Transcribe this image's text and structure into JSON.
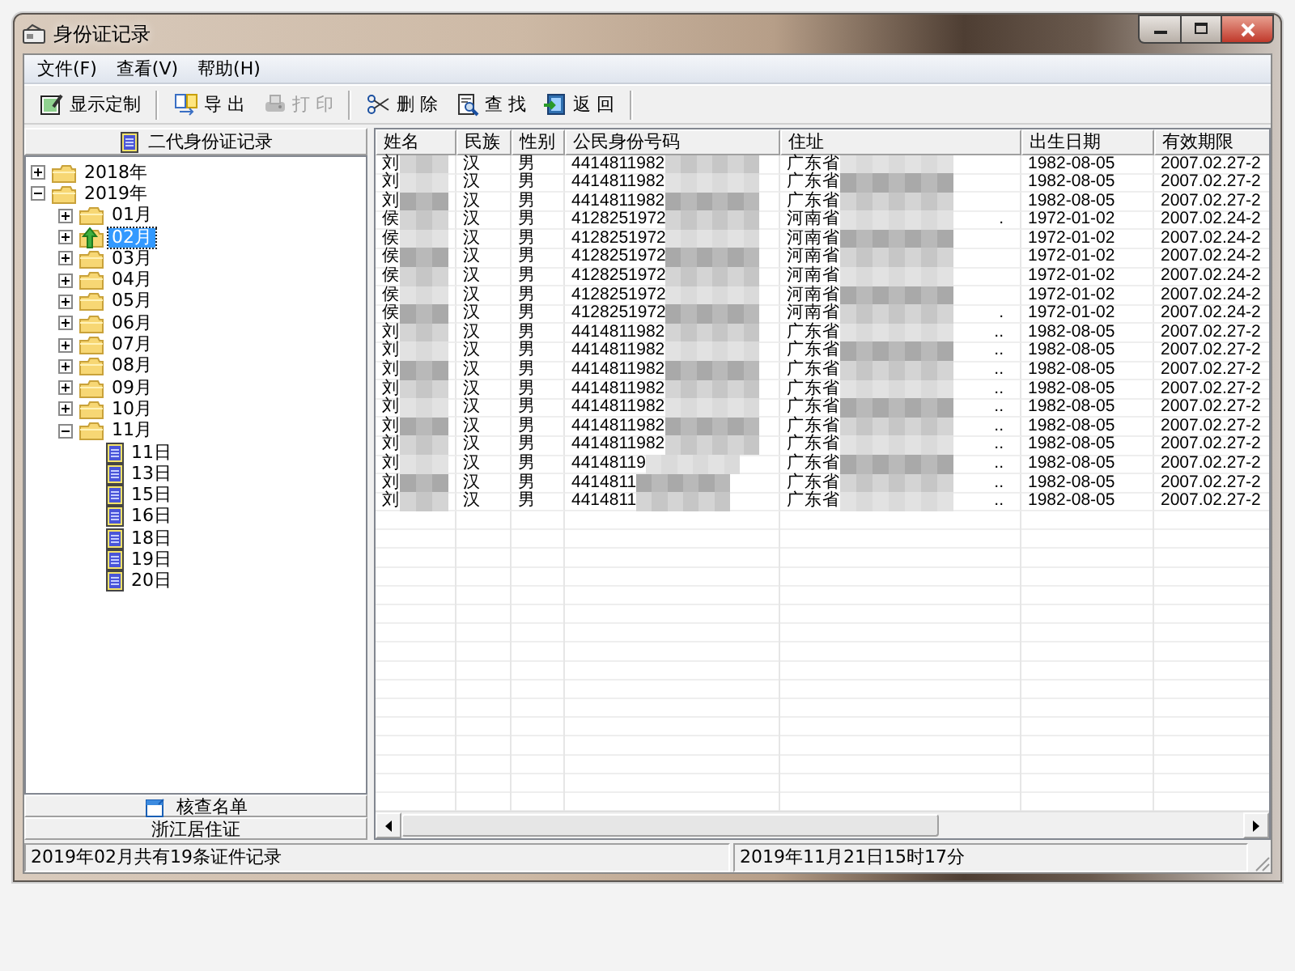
{
  "window": {
    "title": "身份证记录"
  },
  "menu": [
    "文件(F)",
    "查看(V)",
    "帮助(H)"
  ],
  "toolbar": [
    {
      "items": [
        {
          "label": "显示定制",
          "disabled": false
        }
      ]
    },
    {
      "items": [
        {
          "label": "导 出",
          "disabled": false
        },
        {
          "label": "打 印",
          "disabled": true
        }
      ]
    },
    {
      "items": [
        {
          "label": "删 除",
          "disabled": false
        },
        {
          "label": "查 找",
          "disabled": false
        },
        {
          "label": "返 回",
          "disabled": false
        }
      ]
    }
  ],
  "sidebar": {
    "title": "二代身份证记录",
    "tree": [
      {
        "label": "2018年",
        "kind": "folder",
        "expanded": false,
        "selected": false
      },
      {
        "label": "2019年",
        "kind": "folder",
        "expanded": true,
        "selected": false,
        "children": [
          {
            "label": "01月",
            "kind": "folder",
            "expanded": false,
            "selected": false
          },
          {
            "label": "02月",
            "kind": "folder",
            "expanded": false,
            "selected": true
          },
          {
            "label": "03月",
            "kind": "folder",
            "expanded": false,
            "selected": false
          },
          {
            "label": "04月",
            "kind": "folder",
            "expanded": false,
            "selected": false
          },
          {
            "label": "05月",
            "kind": "folder",
            "expanded": false,
            "selected": false
          },
          {
            "label": "06月",
            "kind": "folder",
            "expanded": false,
            "selected": false
          },
          {
            "label": "07月",
            "kind": "folder",
            "expanded": false,
            "selected": false
          },
          {
            "label": "08月",
            "kind": "folder",
            "expanded": false,
            "selected": false
          },
          {
            "label": "09月",
            "kind": "folder",
            "expanded": false,
            "selected": false
          },
          {
            "label": "10月",
            "kind": "folder",
            "expanded": false,
            "selected": false
          },
          {
            "label": "11月",
            "kind": "folder",
            "expanded": true,
            "selected": false,
            "children": [
              {
                "label": "11日",
                "kind": "day",
                "selected": false
              },
              {
                "label": "13日",
                "kind": "day",
                "selected": false
              },
              {
                "label": "15日",
                "kind": "day",
                "selected": false
              },
              {
                "label": "16日",
                "kind": "day",
                "selected": false
              },
              {
                "label": "18日",
                "kind": "day",
                "selected": false
              },
              {
                "label": "19日",
                "kind": "day",
                "selected": false
              },
              {
                "label": "20日",
                "kind": "day",
                "selected": false
              }
            ]
          }
        ]
      }
    ],
    "bottom_buttons": [
      "核查名单",
      "浙江居住证"
    ]
  },
  "table": {
    "columns": [
      "姓名",
      "民族",
      "性别",
      "公民身份号码",
      "住址",
      "出生日期",
      "有效期限"
    ],
    "rows": [
      {
        "name": "刘",
        "ethnicity": "汉",
        "sex": "男",
        "id_number": "4414811982",
        "address": "广东省",
        "birth_date": "1982-08-05",
        "valid_period": "2007.02.27-2"
      },
      {
        "name": "刘",
        "ethnicity": "汉",
        "sex": "男",
        "id_number": "4414811982",
        "address": "广东省",
        "birth_date": "1982-08-05",
        "valid_period": "2007.02.27-2"
      },
      {
        "name": "刘",
        "ethnicity": "汉",
        "sex": "男",
        "id_number": "4414811982",
        "address": "广东省",
        "birth_date": "1982-08-05",
        "valid_period": "2007.02.27-2"
      },
      {
        "name": "侯",
        "ethnicity": "汉",
        "sex": "男",
        "id_number": "4128251972",
        "address": "河南省",
        "address_end": ".",
        "birth_date": "1972-01-02",
        "valid_period": "2007.02.24-2"
      },
      {
        "name": "侯",
        "ethnicity": "汉",
        "sex": "男",
        "id_number": "4128251972",
        "address": "河南省",
        "birth_date": "1972-01-02",
        "valid_period": "2007.02.24-2"
      },
      {
        "name": "侯",
        "ethnicity": "汉",
        "sex": "男",
        "id_number": "4128251972",
        "address": "河南省",
        "birth_date": "1972-01-02",
        "valid_period": "2007.02.24-2"
      },
      {
        "name": "侯",
        "ethnicity": "汉",
        "sex": "男",
        "id_number": "4128251972",
        "address": "河南省",
        "birth_date": "1972-01-02",
        "valid_period": "2007.02.24-2"
      },
      {
        "name": "侯",
        "ethnicity": "汉",
        "sex": "男",
        "id_number": "4128251972",
        "address": "河南省",
        "birth_date": "1972-01-02",
        "valid_period": "2007.02.24-2"
      },
      {
        "name": "侯",
        "ethnicity": "汉",
        "sex": "男",
        "id_number": "4128251972",
        "address": "河南省",
        "address_end": ".",
        "birth_date": "1972-01-02",
        "valid_period": "2007.02.24-2"
      },
      {
        "name": "刘",
        "ethnicity": "汉",
        "sex": "男",
        "id_number": "4414811982",
        "address": "广东省",
        "address_end": "..",
        "birth_date": "1982-08-05",
        "valid_period": "2007.02.27-2"
      },
      {
        "name": "刘",
        "ethnicity": "汉",
        "sex": "男",
        "id_number": "4414811982",
        "address": "广东省",
        "address_end": "..",
        "birth_date": "1982-08-05",
        "valid_period": "2007.02.27-2"
      },
      {
        "name": "刘",
        "ethnicity": "汉",
        "sex": "男",
        "id_number": "4414811982",
        "address": "广东省",
        "address_end": "..",
        "birth_date": "1982-08-05",
        "valid_period": "2007.02.27-2"
      },
      {
        "name": "刘",
        "ethnicity": "汉",
        "sex": "男",
        "id_number": "4414811982",
        "address": "广东省",
        "address_end": "..",
        "birth_date": "1982-08-05",
        "valid_period": "2007.02.27-2"
      },
      {
        "name": "刘",
        "ethnicity": "汉",
        "sex": "男",
        "id_number": "4414811982",
        "address": "广东省",
        "address_end": "..",
        "birth_date": "1982-08-05",
        "valid_period": "2007.02.27-2"
      },
      {
        "name": "刘",
        "ethnicity": "汉",
        "sex": "男",
        "id_number": "4414811982",
        "address": "广东省",
        "address_end": "..",
        "birth_date": "1982-08-05",
        "valid_period": "2007.02.27-2"
      },
      {
        "name": "刘",
        "ethnicity": "汉",
        "sex": "男",
        "id_number": "4414811982",
        "address": "广东省",
        "address_end": "..",
        "birth_date": "1982-08-05",
        "valid_period": "2007.02.27-2"
      },
      {
        "name": "刘",
        "ethnicity": "汉",
        "sex": "男",
        "id_number": "44148119",
        "address": "广东省",
        "address_end": "..",
        "birth_date": "1982-08-05",
        "valid_period": "2007.02.27-2"
      },
      {
        "name": "刘",
        "ethnicity": "汉",
        "sex": "男",
        "id_number": "4414811",
        "address": "广东省",
        "address_end": "..",
        "birth_date": "1982-08-05",
        "valid_period": "2007.02.27-2"
      },
      {
        "name": "刘",
        "ethnicity": "汉",
        "sex": "男",
        "id_number": "4414811",
        "address": "广东省",
        "address_end": "..",
        "birth_date": "1982-08-05",
        "valid_period": "2007.02.27-2"
      }
    ]
  },
  "status_bar": [
    "2019年02月共有19条证件记录",
    "2019年11月21日15时17分"
  ]
}
